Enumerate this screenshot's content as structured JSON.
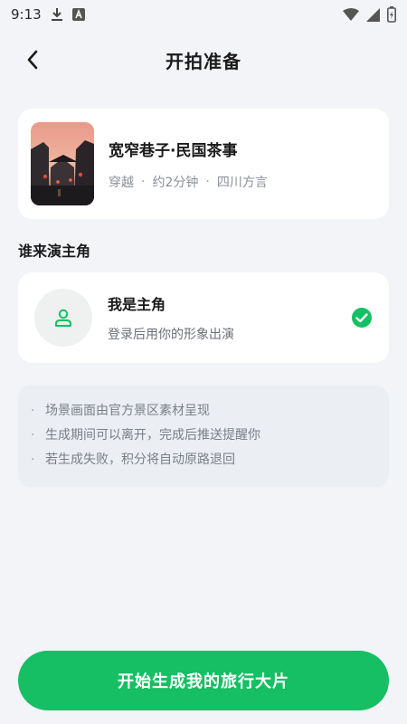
{
  "status_bar": {
    "time": "9:13",
    "icons": [
      "download-icon",
      "a-icon",
      "wifi-icon",
      "signal-icon",
      "battery-icon"
    ]
  },
  "header": {
    "title": "开拍准备",
    "back_icon": "chevron-left-icon"
  },
  "scene": {
    "name": "宽窄巷子·民国茶事",
    "meta": [
      "穿越",
      "约2分钟",
      "四川方言"
    ],
    "separator": "·",
    "thumbnail_icon": "old-street-photo"
  },
  "section": {
    "title": "谁来演主角"
  },
  "role": {
    "name": "我是主角",
    "description": "登录后用你的形象出演",
    "avatar_icon": "person-icon",
    "selected": true,
    "check_icon": "check-circle-icon"
  },
  "notes": [
    "场景画面由官方景区素材呈现",
    "生成期间可以离开，完成后推送提醒你",
    "若生成失败，积分将自动原路退回"
  ],
  "note_bullet": "·",
  "cta": {
    "label": "开始生成我的旅行大片"
  },
  "colors": {
    "accent": "#16bf63",
    "background": "#f2f4f7",
    "card": "#ffffff",
    "muted_text": "#8a8f98"
  }
}
